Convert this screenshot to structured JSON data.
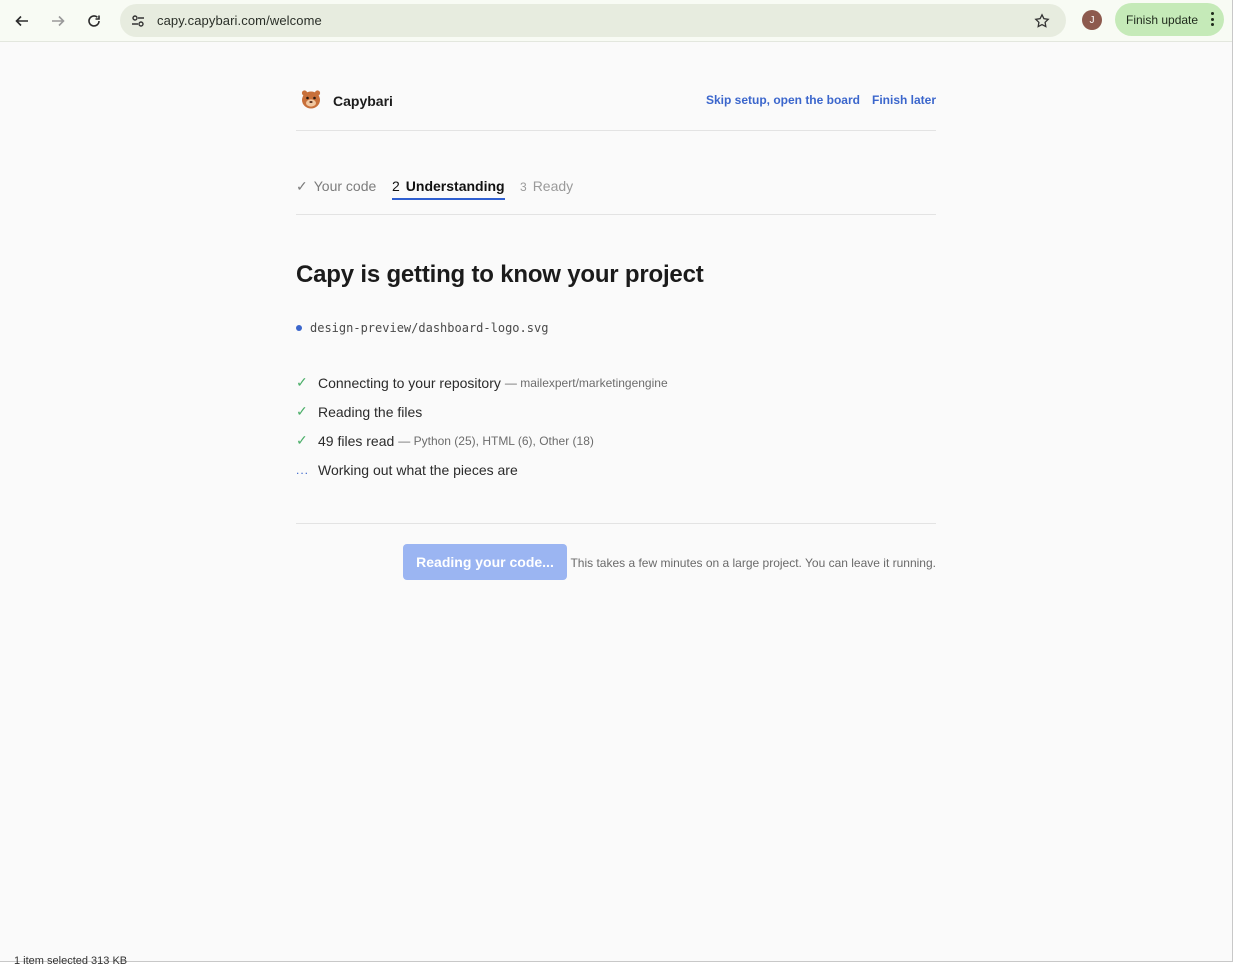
{
  "browser": {
    "url": "capy.capybari.com/welcome",
    "avatar_initial": "J",
    "update_label": "Finish update"
  },
  "header": {
    "brand": "Capybari",
    "links": [
      "Skip setup, open the board",
      "Finish later"
    ]
  },
  "steps": [
    {
      "num": "✓",
      "label": "Your code",
      "state": "done"
    },
    {
      "num": "2",
      "label": "Understanding",
      "state": "active"
    },
    {
      "num": "3",
      "label": "Ready",
      "state": "upcoming"
    }
  ],
  "main": {
    "title": "Capy is getting to know your project",
    "current_file": "design-preview/dashboard-logo.svg",
    "progress": [
      {
        "mark": "✓",
        "text": "Connecting to your repository",
        "detail": "— mailexpert/marketingengine"
      },
      {
        "mark": "✓",
        "text": "Reading the files",
        "detail": ""
      },
      {
        "mark": "✓",
        "text": "49 files read",
        "detail": "— Python (25), HTML (6), Other (18)"
      },
      {
        "mark": "...",
        "text": "Working out what the pieces are",
        "detail": ""
      }
    ]
  },
  "footer": {
    "button_label": "Reading your code...",
    "note": "This takes a few minutes on a large project. You can leave it running."
  },
  "status_bar": "1 item selected  313 KB",
  "colors": {
    "accent": "#3b66cc",
    "check": "#4caf6a",
    "button_disabled": "#9bb5f2",
    "chip": "#c5eab8"
  }
}
